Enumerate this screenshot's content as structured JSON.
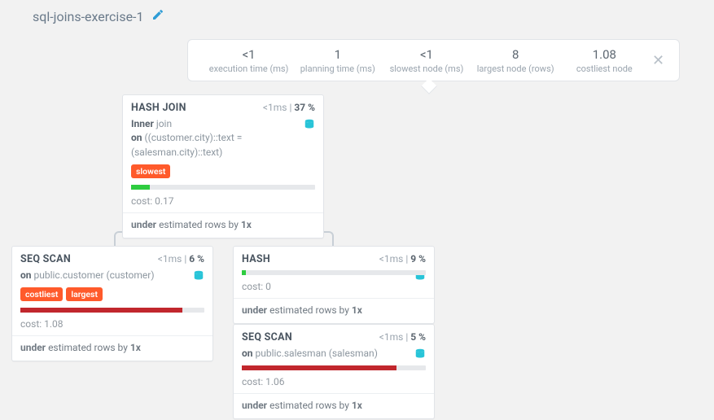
{
  "title": "sql-joins-exercise-1",
  "stats": [
    {
      "value": "<1",
      "label": "execution time (ms)"
    },
    {
      "value": "1",
      "label": "planning time (ms)"
    },
    {
      "value": "<1",
      "label": "slowest node (ms)"
    },
    {
      "value": "8",
      "label": "largest node (rows)"
    },
    {
      "value": "1.08",
      "label": "costliest node"
    }
  ],
  "nodes": {
    "hashjoin": {
      "name": "HASH JOIN",
      "time": "<1ms",
      "pct": "37",
      "desc_pre": "Inner ",
      "desc_join": "join",
      "desc_on": "on ",
      "desc_cond": "((customer.city)::text = (salesman.city)::text)",
      "tag": "slowest",
      "bar_color": "#2ecc40",
      "bar_width": "10%",
      "cost": "cost: 0.17",
      "est_lead": "under ",
      "est_mid": "estimated rows by ",
      "est_x": "1x"
    },
    "seqscan_customer": {
      "name": "SEQ SCAN",
      "time": "<1ms",
      "pct": "6",
      "desc_on": "on ",
      "desc_table": "public.customer (customer)",
      "tag1": "costliest",
      "tag2": "largest",
      "bar_color": "#c1272d",
      "bar_width": "88%",
      "cost": "cost: 1.08",
      "est_lead": "under ",
      "est_mid": "estimated rows by ",
      "est_x": "1x"
    },
    "hash": {
      "name": "HASH",
      "time": "<1ms",
      "pct": "9",
      "bar_color": "#2ecc40",
      "bar_width": "2%",
      "cost": "cost: 0",
      "est_lead": "under ",
      "est_mid": "estimated rows by ",
      "est_x": "1x"
    },
    "seqscan_salesman": {
      "name": "SEQ SCAN",
      "time": "<1ms",
      "pct": "5",
      "desc_on": "on ",
      "desc_table": "public.salesman (salesman)",
      "bar_color": "#c1272d",
      "bar_width": "84%",
      "cost": "cost: 1.06",
      "est_lead": "under ",
      "est_mid": "estimated rows by ",
      "est_x": "1x"
    }
  }
}
